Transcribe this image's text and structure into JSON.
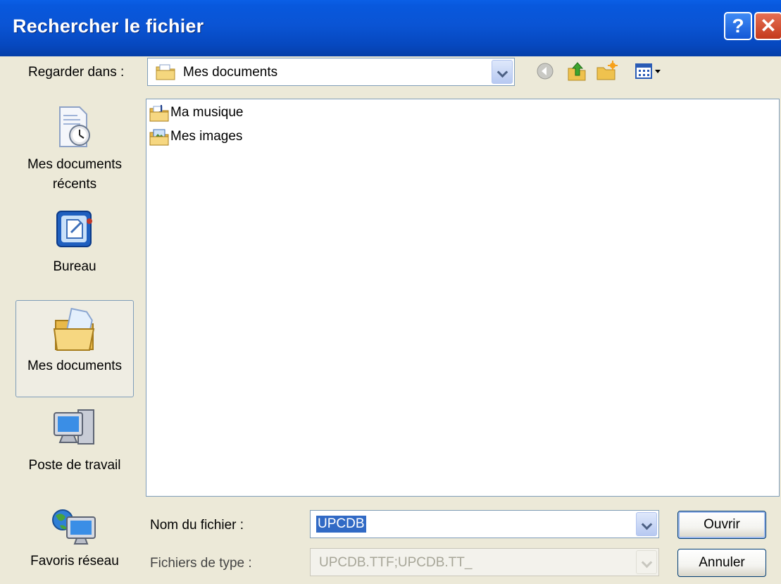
{
  "window": {
    "title": "Rechercher le fichier",
    "help_label": "?",
    "close_label": "✕"
  },
  "lookin": {
    "label": "Regarder dans :",
    "value": "Mes documents"
  },
  "toolbar": {
    "icons": [
      "back-icon",
      "up-folder-icon",
      "new-folder-icon",
      "view-menu-icon"
    ]
  },
  "places": [
    {
      "label": "Mes documents récents",
      "icon": "recent-documents-icon",
      "selected": false
    },
    {
      "label": "Bureau",
      "icon": "desktop-icon",
      "selected": false
    },
    {
      "label": "Mes documents",
      "icon": "my-documents-icon",
      "selected": true
    },
    {
      "label": "Poste de travail",
      "icon": "my-computer-icon",
      "selected": false
    },
    {
      "label": "Favoris réseau",
      "icon": "network-places-icon",
      "selected": false
    }
  ],
  "files": [
    {
      "name": "Ma musique",
      "icon": "music-folder-icon"
    },
    {
      "name": "Mes images",
      "icon": "pictures-folder-icon"
    }
  ],
  "filename": {
    "label": "Nom du fichier :",
    "value": "UPCDB"
  },
  "filetype": {
    "label": "Fichiers de type :",
    "value": "UPCDB.TTF;UPCDB.TT_"
  },
  "buttons": {
    "open": "Ouvrir",
    "cancel": "Annuler"
  }
}
